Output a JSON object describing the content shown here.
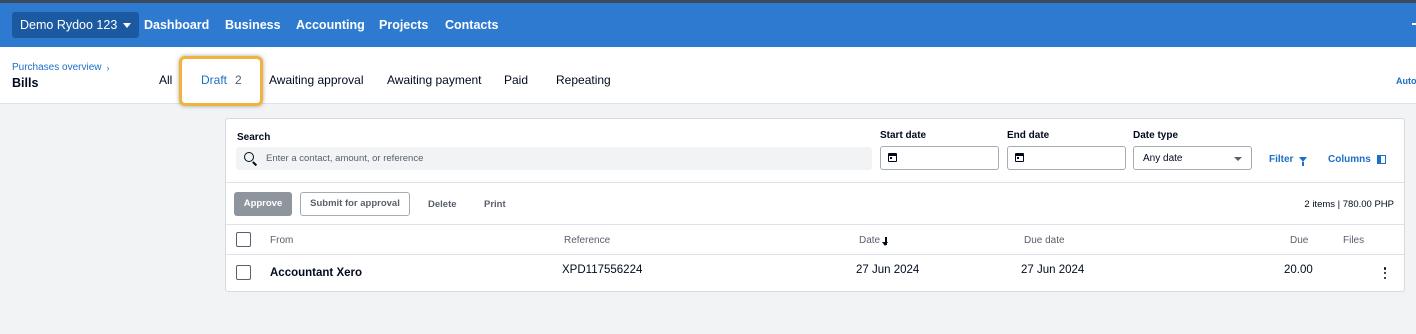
{
  "topnav": {
    "org_name": "Demo Rydoo 123",
    "items": [
      "Dashboard",
      "Business",
      "Accounting",
      "Projects",
      "Contacts"
    ]
  },
  "header": {
    "breadcrumb": "Purchases overview",
    "title": "Bills",
    "auto_link": "Auto"
  },
  "tabs": {
    "all": "All",
    "draft": "Draft",
    "draft_count": "2",
    "awaiting_approval": "Awaiting approval",
    "awaiting_payment": "Awaiting payment",
    "paid": "Paid",
    "repeating": "Repeating",
    "active": "Draft"
  },
  "filters": {
    "search_label": "Search",
    "search_placeholder": "Enter a contact, amount, or reference",
    "start_date_label": "Start date",
    "end_date_label": "End date",
    "date_type_label": "Date type",
    "date_type_value": "Any date",
    "filter_label": "Filter",
    "columns_label": "Columns"
  },
  "actions": {
    "approve": "Approve",
    "submit": "Submit for approval",
    "delete": "Delete",
    "print": "Print",
    "summary": "2 items | 780.00 PHP"
  },
  "table": {
    "headers": {
      "from": "From",
      "reference": "Reference",
      "date": "Date",
      "due_date": "Due date",
      "due": "Due",
      "files": "Files"
    },
    "rows": [
      {
        "from": "Accountant Xero",
        "reference": "XPD117556224",
        "date": "27 Jun 2024",
        "due_date": "27 Jun 2024",
        "due": "20.00"
      }
    ]
  },
  "colors": {
    "topbar": "#2e7ad0",
    "link": "#1c6fc7",
    "highlight": "#f0b43c"
  }
}
